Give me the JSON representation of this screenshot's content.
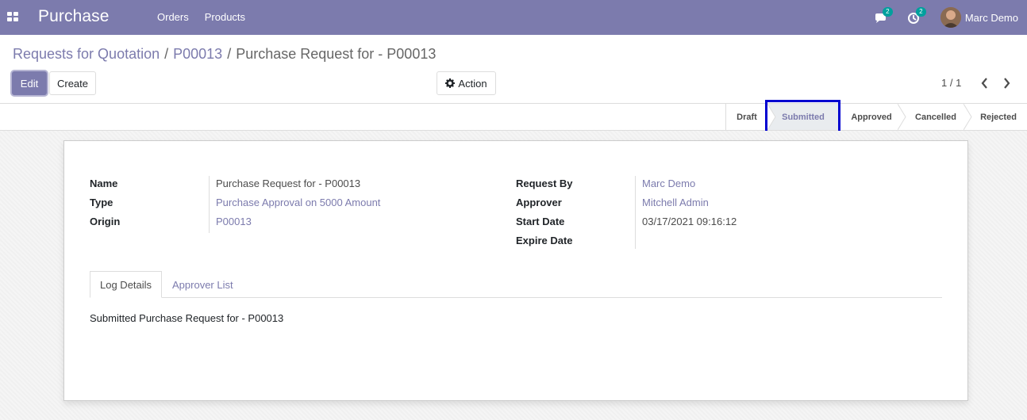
{
  "navbar": {
    "app_name": "Purchase",
    "menu": [
      "Orders",
      "Products"
    ],
    "messages_count": "2",
    "activities_count": "2",
    "user_name": "Marc Demo"
  },
  "breadcrumb": {
    "parent": "Requests for Quotation",
    "record": "P00013",
    "current": "Purchase Request for - P00013",
    "separator": "/"
  },
  "toolbar": {
    "edit_label": "Edit",
    "create_label": "Create",
    "action_label": "Action",
    "pager": "1 / 1"
  },
  "statusbar": {
    "stages": [
      "Draft",
      "Submitted",
      "Approved",
      "Cancelled",
      "Rejected"
    ],
    "active": "Submitted"
  },
  "form": {
    "left": [
      {
        "label": "Name",
        "value": "Purchase Request for - P00013",
        "link": false
      },
      {
        "label": "Type",
        "value": "Purchase Approval on 5000 Amount",
        "link": true
      },
      {
        "label": "Origin",
        "value": "P00013",
        "link": true
      }
    ],
    "right": [
      {
        "label": "Request By",
        "value": "Marc Demo",
        "link": true
      },
      {
        "label": "Approver",
        "value": "Mitchell Admin",
        "link": true
      },
      {
        "label": "Start Date",
        "value": "03/17/2021 09:16:12",
        "link": false
      },
      {
        "label": "Expire Date",
        "value": "",
        "link": false
      }
    ]
  },
  "tabs": {
    "items": [
      "Log Details",
      "Approver List"
    ],
    "active": "Log Details",
    "log_content": "Submitted Purchase Request for - P00013"
  },
  "colors": {
    "brand": "#7c7bad",
    "highlight": "#0000d0",
    "badge": "#00a09d"
  }
}
